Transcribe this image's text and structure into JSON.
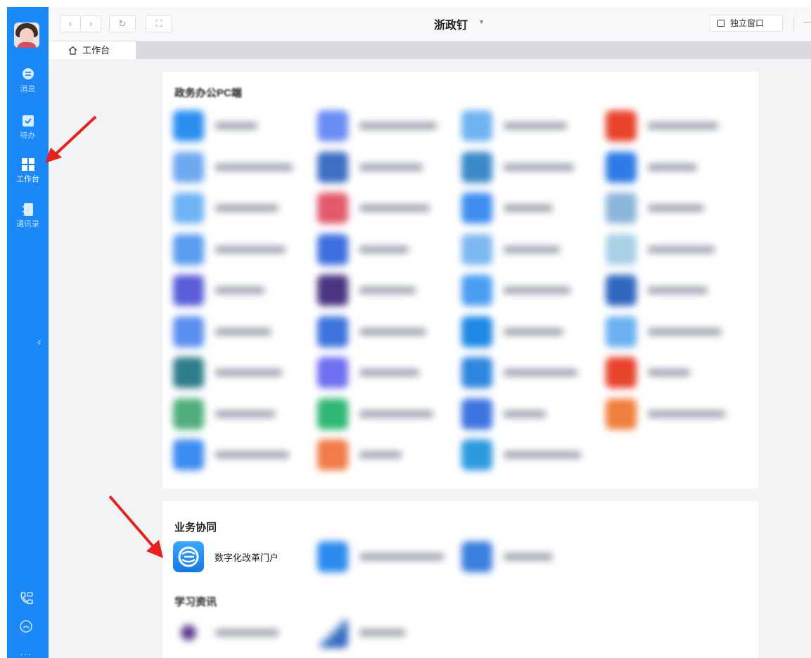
{
  "window": {
    "title": "浙政钉",
    "independent_window_label": "独立窗口"
  },
  "tab": {
    "label": "工作台"
  },
  "sidebar": {
    "items": [
      {
        "label": "消息",
        "icon": "message-icon"
      },
      {
        "label": "待办",
        "icon": "todo-icon"
      },
      {
        "label": "工作台",
        "icon": "workbench-grid-icon"
      },
      {
        "label": "通讯录",
        "icon": "contacts-icon"
      }
    ]
  },
  "sections": {
    "gov_office": {
      "title": "政务办公PC端"
    },
    "business_collab": {
      "title": "业务协同",
      "highlight_app": "数字化改革门户"
    },
    "learning": {
      "title": "学习资讯"
    }
  },
  "colors": {
    "sidebar": "#1a88f7",
    "accent": "#1479e6",
    "annotation_arrow": "#e8201e"
  }
}
